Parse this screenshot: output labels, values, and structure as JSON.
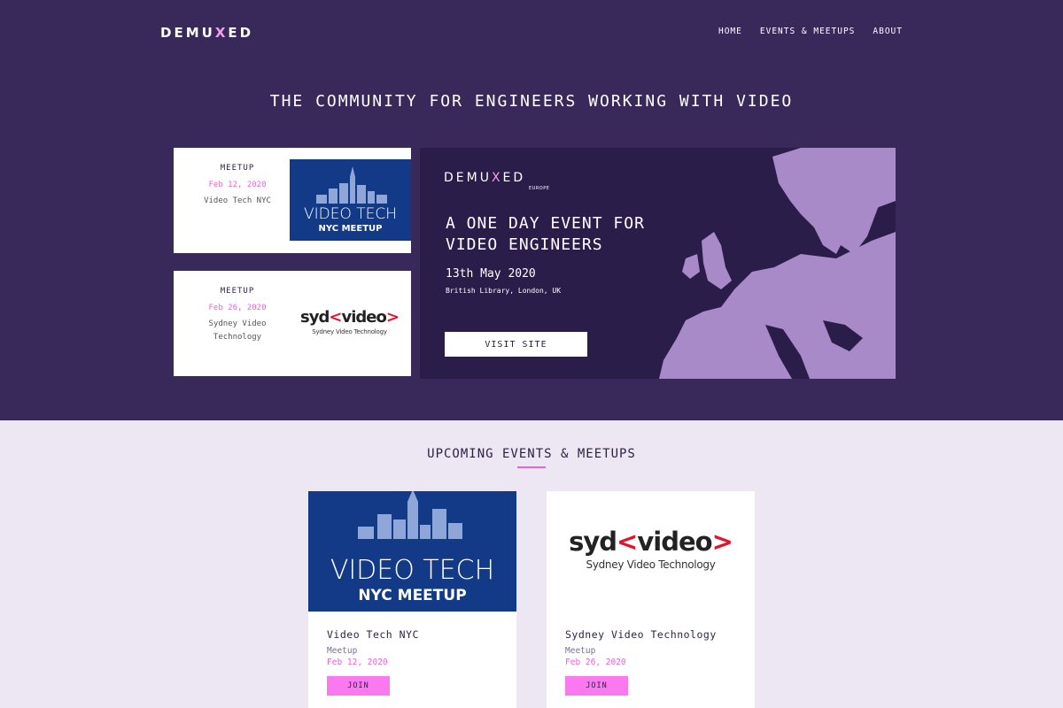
{
  "header": {
    "logo_pre": "DEMU",
    "logo_x": "X",
    "logo_post": "ED",
    "nav": [
      "HOME",
      "EVENTS & MEETUPS",
      "ABOUT"
    ]
  },
  "hero": {
    "tagline": "THE COMMUNITY FOR ENGINEERS WORKING WITH VIDEO"
  },
  "side_cards": [
    {
      "type": "MEETUP",
      "date": "Feb 12, 2020",
      "name": "Video Tech NYC"
    },
    {
      "type": "MEETUP",
      "date": "Feb 26, 2020",
      "name": "Sydney Video Technology"
    }
  ],
  "images": {
    "vt_line1": "VIDEO TECH",
    "vt_line2": "NYC MEETUP",
    "syd_pre": "syd",
    "syd_lt": "<",
    "syd_word": "video",
    "syd_gt": ">",
    "syd_sub": "Sydney Video Technology"
  },
  "promo": {
    "logo_pre": "DEMU",
    "logo_x": "X",
    "logo_post": "ED",
    "logo_sub": "EUROPE",
    "headline": "A ONE DAY EVENT FOR VIDEO ENGINEERS",
    "date": "13th May 2020",
    "location": "British Library, London, UK",
    "button": "VISIT SITE"
  },
  "upcoming": {
    "title": "UPCOMING EVENTS & MEETUPS",
    "cards": [
      {
        "title": "Video Tech NYC",
        "type": "Meetup",
        "date": "Feb 12, 2020",
        "button": "JOIN"
      },
      {
        "title": "Sydney Video Technology",
        "type": "Meetup",
        "date": "Feb 26, 2020",
        "button": "JOIN"
      }
    ]
  },
  "colors": {
    "hero_bg": "#39295a",
    "promo_bg": "#2b1d49",
    "accent_pink": "#f060d8",
    "join_button": "#fa78f0",
    "map_fill": "#a98ac8",
    "section_bg": "#ede6f3",
    "nyc_blue": "#133a87"
  },
  "icons": [
    "city-skyline-icon",
    "europe-map-icon"
  ]
}
